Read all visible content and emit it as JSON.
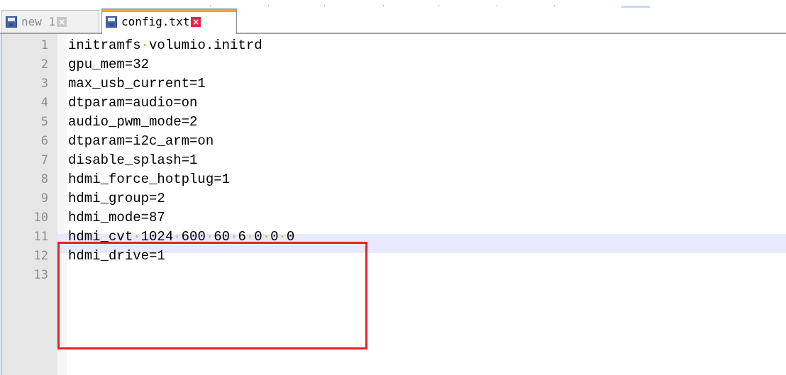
{
  "tabs": [
    {
      "label": "new 1",
      "icon": "save-disk-icon",
      "close": "×",
      "active": false
    },
    {
      "label": "config.txt",
      "icon": "save-disk-icon",
      "close": "×",
      "active": true
    }
  ],
  "editor": {
    "current_line": 10,
    "highlighted_lines": [
      9,
      12
    ],
    "lines": [
      {
        "n": "1",
        "text": "initramfs volumio.initrd"
      },
      {
        "n": "2",
        "text": "gpu_mem=32"
      },
      {
        "n": "3",
        "text": "max_usb_current=1"
      },
      {
        "n": "4",
        "text": "dtparam=audio=on"
      },
      {
        "n": "5",
        "text": "audio_pwm_mode=2"
      },
      {
        "n": "6",
        "text": "dtparam=i2c_arm=on"
      },
      {
        "n": "7",
        "text": "disable_splash=1"
      },
      {
        "n": "8",
        "text": "hdmi_force_hotplug=1"
      },
      {
        "n": "9",
        "text": "hdmi_group=2"
      },
      {
        "n": "10",
        "text": "hdmi_mode=87"
      },
      {
        "n": "11",
        "text": "hdmi_cvt 1024 600 60 6 0 0 0"
      },
      {
        "n": "12",
        "text": "hdmi_drive=1"
      },
      {
        "n": "13",
        "text": ""
      }
    ]
  },
  "colors": {
    "accent_tab": "#f3a23a",
    "close_active": "#e2274f",
    "highlight_box": "#e02424",
    "current_line": "#e8e8ff",
    "whitespace_dot": "#f0a030"
  }
}
